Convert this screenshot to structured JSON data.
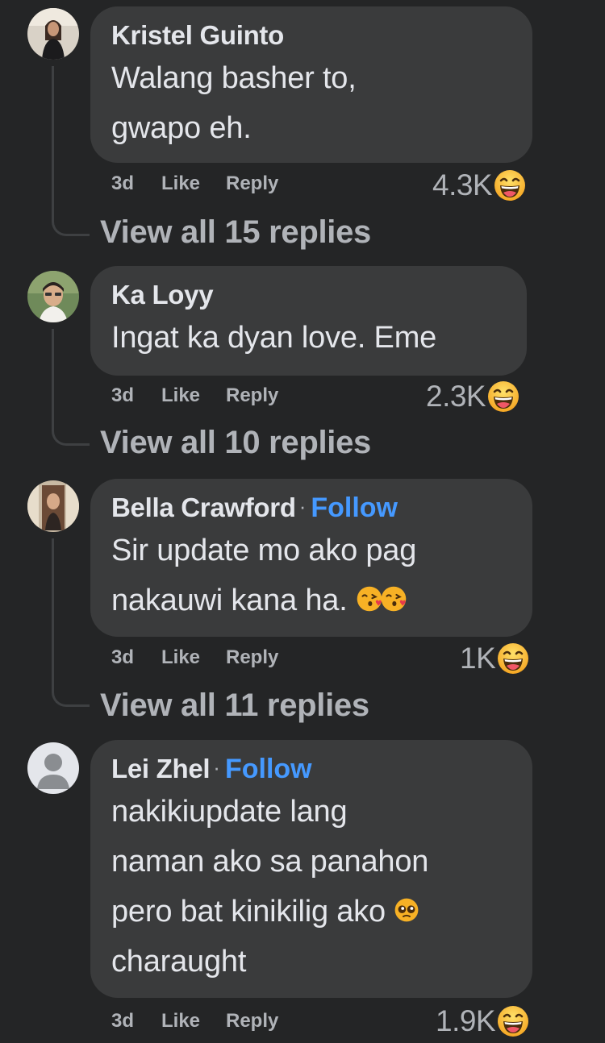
{
  "comments": [
    {
      "author": "Kristel Guinto",
      "follow": "",
      "lines": [
        "Walang basher to,",
        "gwapo eh."
      ],
      "time": "3d",
      "like": "Like",
      "reply": "Reply",
      "reaction_count": "4.3K",
      "reaction_icon": "haha-icon",
      "view_replies": "View all 15 replies"
    },
    {
      "author": "Ka Loyy",
      "follow": "",
      "lines": [
        "Ingat ka dyan love. Eme"
      ],
      "time": "3d",
      "like": "Like",
      "reply": "Reply",
      "reaction_count": "2.3K",
      "reaction_icon": "haha-icon",
      "view_replies": "View all 10 replies"
    },
    {
      "author": "Bella Crawford",
      "dot": "·",
      "follow": "Follow",
      "lines": [
        "Sir update mo ako pag",
        "nakauwi kana ha."
      ],
      "line_emojis": [
        "kissing-heart-emoji",
        "kissing-heart-emoji"
      ],
      "time": "3d",
      "like": "Like",
      "reply": "Reply",
      "reaction_count": "1K",
      "reaction_icon": "haha-icon",
      "view_replies": "View all 11 replies"
    },
    {
      "author": "Lei Zhel",
      "dot": "·",
      "follow": "Follow",
      "lines": [
        "nakikiupdate lang",
        "naman ako sa panahon",
        "pero bat kinikilig ako",
        "charaught"
      ],
      "line_emojis": [
        "pleading-face-emoji"
      ],
      "time": "3d",
      "like": "Like",
      "reply": "Reply",
      "reaction_count": "1.9K",
      "reaction_icon": "haha-icon"
    }
  ],
  "colors": {
    "background": "#242526",
    "bubble": "#3a3b3c",
    "text": "#e4e6eb",
    "secondary_text": "#b0b3b8",
    "follow_link": "#4599ff",
    "haha_yellow": "#f7b125"
  }
}
